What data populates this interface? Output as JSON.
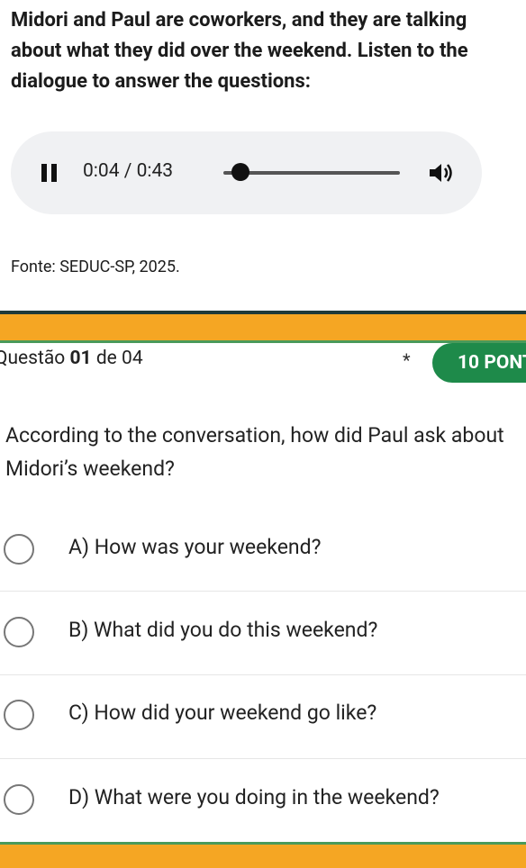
{
  "intro": "Midori and Paul are coworkers, and they are talking about what they did over the weekend. Listen to the dialogue to answer the questions:",
  "player": {
    "time": "0:04 / 0:43",
    "progress": 0.09
  },
  "source": "Fonte: SEDUC-SP, 2025.",
  "question_header": {
    "prefix": "Questão",
    "number": "01",
    "suffix": "de 04",
    "asterisk": "*",
    "points": "10 PONT"
  },
  "question": "According to the conversation, how did Paul ask about Midori’s weekend?",
  "options": [
    {
      "label": "A) How was your weekend?"
    },
    {
      "label": "B) What did you do this weekend?"
    },
    {
      "label": "C) How did your weekend go like?"
    },
    {
      "label": "D) What were you doing in the weekend?"
    }
  ],
  "colors": {
    "accent_band": "#f5a623",
    "points_badge": "#1e8a4a",
    "divider": "#4a9a5a"
  }
}
